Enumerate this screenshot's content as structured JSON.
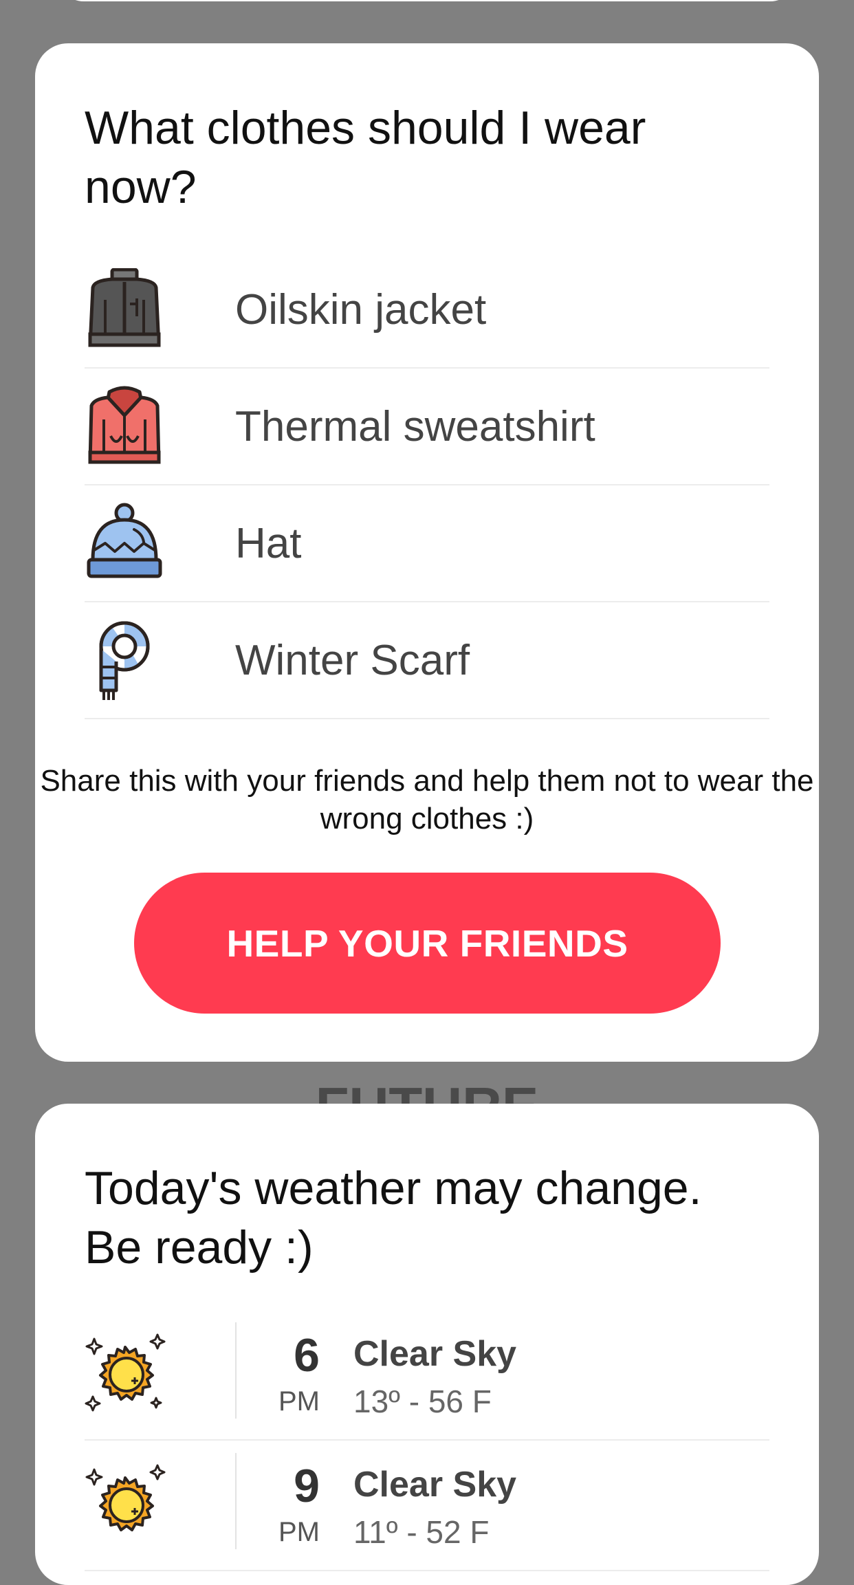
{
  "clothes_card": {
    "title": "What clothes should I wear now?",
    "items": [
      {
        "label": "Oilskin jacket",
        "icon": "jacket-icon"
      },
      {
        "label": "Thermal sweatshirt",
        "icon": "sweatshirt-icon"
      },
      {
        "label": "Hat",
        "icon": "hat-icon"
      },
      {
        "label": "Winter Scarf",
        "icon": "scarf-icon"
      }
    ],
    "share_text": "Share this with your friends and help them not to wear the wrong clothes :)",
    "button_label": "HELP YOUR FRIENDS"
  },
  "section_heading": "FUTURE",
  "forecast_card": {
    "title": "Today's weather may change. Be ready :)",
    "rows": [
      {
        "hour": "6",
        "ampm": "PM",
        "condition": "Clear Sky",
        "temp": "13º - 56 F",
        "icon": "sun-icon"
      },
      {
        "hour": "9",
        "ampm": "PM",
        "condition": "Clear Sky",
        "temp": "11º - 52 F",
        "icon": "sun-icon"
      }
    ]
  },
  "colors": {
    "background": "#808080",
    "card": "#ffffff",
    "button": "#ff3b50"
  }
}
